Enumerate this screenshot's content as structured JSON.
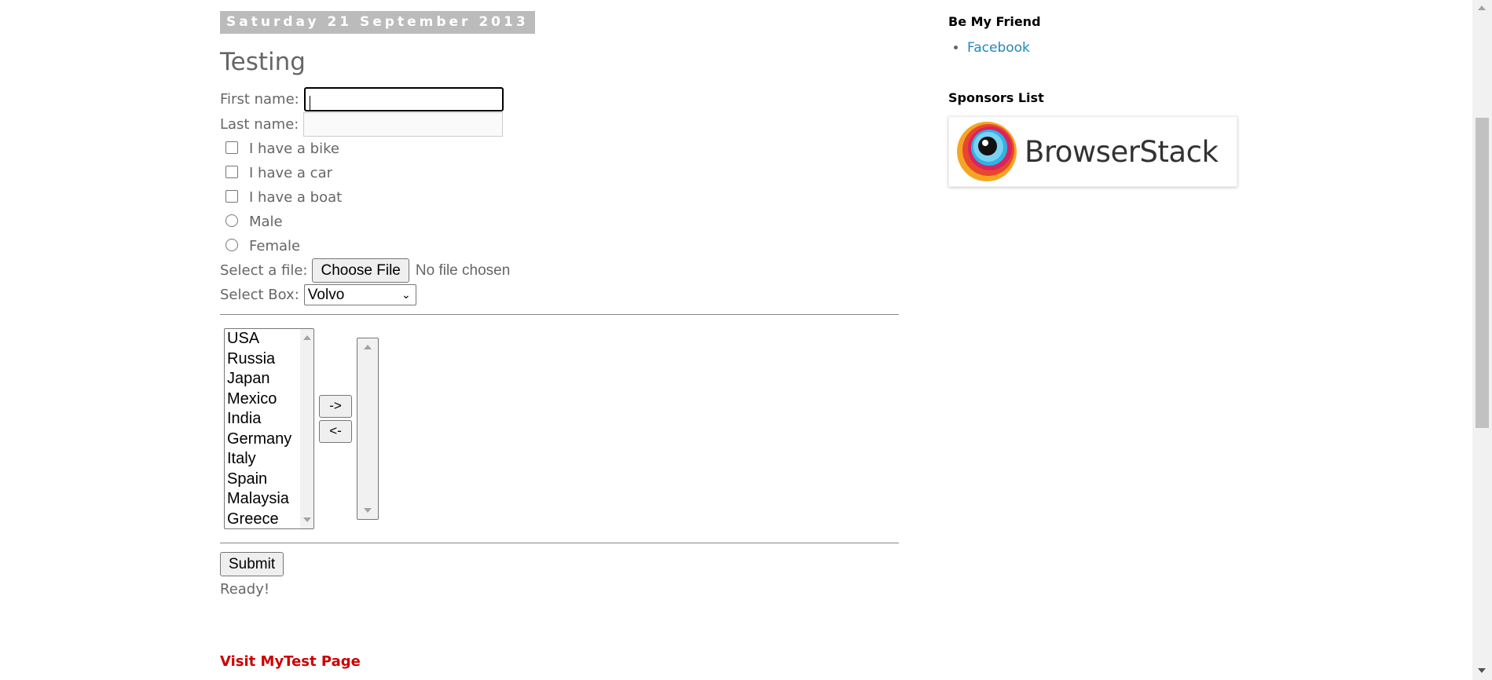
{
  "post": {
    "date": "Saturday 21 September 2013",
    "title": "Testing"
  },
  "form": {
    "first_name_label": "First name:",
    "first_name_value": "",
    "last_name_label": "Last name:",
    "last_name_value": "",
    "checkboxes": [
      "I have a bike",
      "I have a car",
      "I have a boat"
    ],
    "radios": [
      "Male",
      "Female"
    ],
    "file_label": "Select a file:",
    "file_button": "Choose File",
    "file_status": "No file chosen",
    "select_label": "Select Box:",
    "select_value": "Volvo",
    "countries": [
      "USA",
      "Russia",
      "Japan",
      "Mexico",
      "India",
      "Germany",
      "Italy",
      "Spain",
      "Malaysia",
      "Greece"
    ],
    "move_right_label": "->",
    "move_left_label": "<-",
    "submit_label": "Submit",
    "status_text": "Ready!"
  },
  "links": {
    "visit": "Visit MyTest Page"
  },
  "sidebar": {
    "friend_title": "Be My Friend",
    "friend_links": [
      "Facebook"
    ],
    "sponsors_title": "Sponsors List",
    "sponsor_name": "BrowserStack"
  },
  "colors": {
    "link_blue": "#2288bb",
    "link_red": "#cc0000",
    "date_bg": "#bbbbbb",
    "text_gray": "#666666"
  }
}
